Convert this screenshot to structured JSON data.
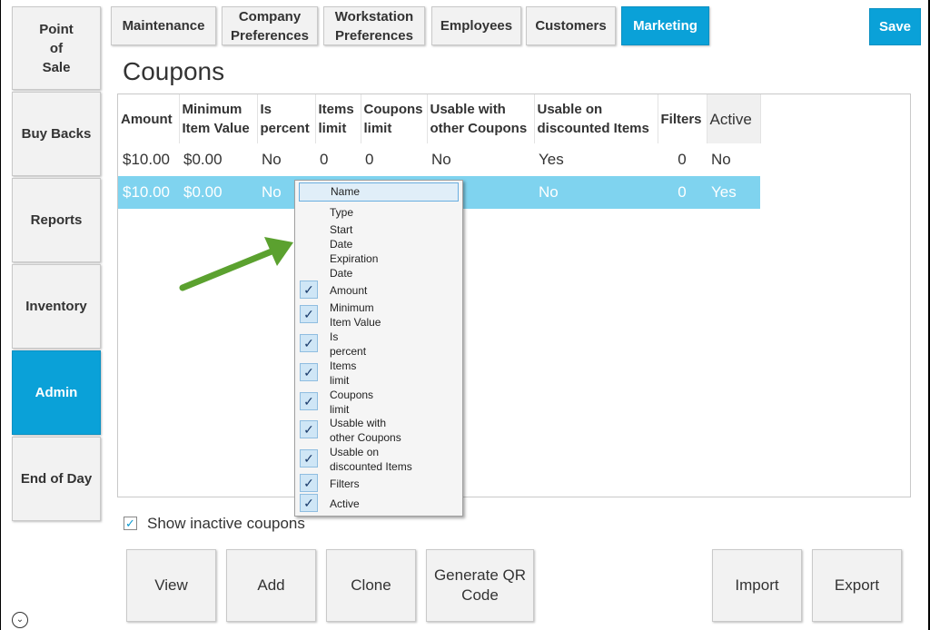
{
  "nav": {
    "items": [
      {
        "label": "Point\nof\nSale"
      },
      {
        "label": "Buy Backs"
      },
      {
        "label": "Reports"
      },
      {
        "label": "Inventory"
      },
      {
        "label": "Admin"
      },
      {
        "label": "End of Day"
      }
    ]
  },
  "tabs": [
    {
      "label": "Maintenance"
    },
    {
      "label": "Company\nPreferences"
    },
    {
      "label": "Workstation\nPreferences"
    },
    {
      "label": "Employees"
    },
    {
      "label": "Customers"
    },
    {
      "label": "Marketing"
    }
  ],
  "save_label": "Save",
  "page_title": "Coupons",
  "grid": {
    "columns": [
      "Amount",
      "Minimum\nItem Value",
      "Is\npercent",
      "Items\nlimit",
      "Coupons\nlimit",
      "Usable with\nother Coupons",
      "Usable on\ndiscounted Items",
      "Filters",
      "Active"
    ],
    "rows": [
      [
        "$10.00",
        "$0.00",
        "No",
        "0",
        "0",
        "No",
        "Yes",
        "0",
        "No"
      ],
      [
        "$10.00",
        "$0.00",
        "No",
        "",
        "",
        "",
        "No",
        "0",
        "Yes"
      ]
    ]
  },
  "context_menu": {
    "items": [
      {
        "label": "Name"
      },
      {
        "label": "Type"
      },
      {
        "label": "Start\nDate"
      },
      {
        "label": "Expiration\nDate"
      },
      {
        "label": "Amount",
        "checked": true
      },
      {
        "label": "Minimum\nItem Value",
        "checked": true
      },
      {
        "label": "Is\npercent",
        "checked": true
      },
      {
        "label": "Items\nlimit",
        "checked": true
      },
      {
        "label": "Coupons\nlimit",
        "checked": true
      },
      {
        "label": "Usable with\nother Coupons",
        "checked": true
      },
      {
        "label": "Usable on\ndiscounted Items",
        "checked": true
      },
      {
        "label": "Filters",
        "checked": true
      },
      {
        "label": "Active",
        "checked": true
      }
    ]
  },
  "show_inactive": {
    "label": "Show inactive coupons",
    "checked": true
  },
  "buttons": {
    "view": "View",
    "add": "Add",
    "clone": "Clone",
    "generate_qr": "Generate QR\nCode",
    "import": "Import",
    "export": "Export"
  },
  "colors": {
    "accent": "#0aa1d8",
    "selected_row": "#7fd3ef",
    "arrow": "#5ba12f"
  }
}
